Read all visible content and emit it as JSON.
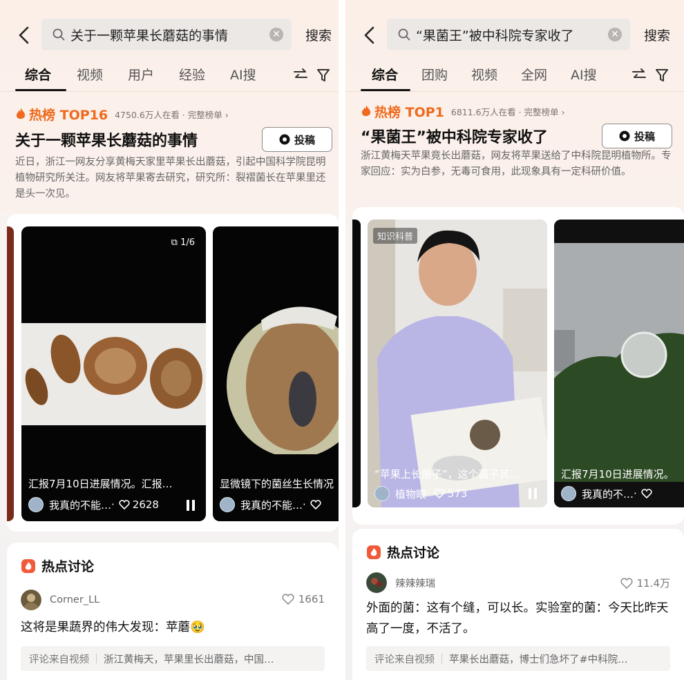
{
  "panels": [
    {
      "search": {
        "query": "关于一颗苹果长蘑菇的事情",
        "button": "搜索"
      },
      "tabs": [
        "综合",
        "视频",
        "用户",
        "经验",
        "AI搜"
      ],
      "hot": {
        "rank": "热榜 TOP16",
        "meta": "4750.6万人在看 · 完整榜单 ›",
        "title": "关于一颗苹果长蘑菇的事情",
        "submit": "投稿",
        "desc": "近日，浙江一网友分享黄梅天家里苹果长出蘑菇，引起中国科学院昆明植物研究所关注。网友将苹果寄去研究，研究所：裂褶菌长在苹果里还是头一次见。"
      },
      "videos": [
        {
          "caption": "汇报7月10日进展情况。汇报…",
          "author": "我真的不能…",
          "likes": "2628",
          "badge": "1/6"
        },
        {
          "caption": "显微镜下的菌丝生长情况",
          "author": "我真的不能…",
          "likes": ""
        }
      ],
      "discussion": {
        "title": "热点讨论",
        "user": "Corner_LL",
        "likes": "1661",
        "text": "这将是果蔬界的伟大发现：苹蘑🥹",
        "source_label": "评论来自视频",
        "source_text": "浙江黄梅天，苹果里长出蘑菇，中国…"
      }
    },
    {
      "search": {
        "query": "“果菌王”被中科院专家收了",
        "button": "搜索"
      },
      "tabs": [
        "综合",
        "团购",
        "视频",
        "全网",
        "AI搜"
      ],
      "hot": {
        "rank": "热榜 TOP1",
        "meta": "6811.6万人在看 · 完整榜单 ›",
        "title": "“果菌王”被中科院专家收了",
        "submit": "投稿",
        "desc": "浙江黄梅天苹果竟长出蘑菇，网友将苹果送给了中科院昆明植物所。专家回应：实为白参，无毒可食用，此现象具有一定科研价值。"
      },
      "videos": [
        {
          "caption": "“苹果上长菌子”，这个菌子其…",
          "author": "植物眼",
          "likes": "573",
          "tag": "知识科普"
        },
        {
          "caption": "汇报7月10日进展情况。",
          "author": "我真的不…",
          "likes": ""
        }
      ],
      "discussion": {
        "title": "热点讨论",
        "user": "辣辣辣瑞",
        "likes": "11.4万",
        "text": "外面的菌：这有个缝，可以长。实验室的菌：今天比昨天高了一度，不活了。",
        "source_label": "评论来自视频",
        "source_text": "苹果长出蘑菇，博士们急坏了#中科院…"
      }
    }
  ],
  "colors": {
    "hot_orange": "#ef6a1e",
    "discussion_red": "#f05a3a"
  }
}
